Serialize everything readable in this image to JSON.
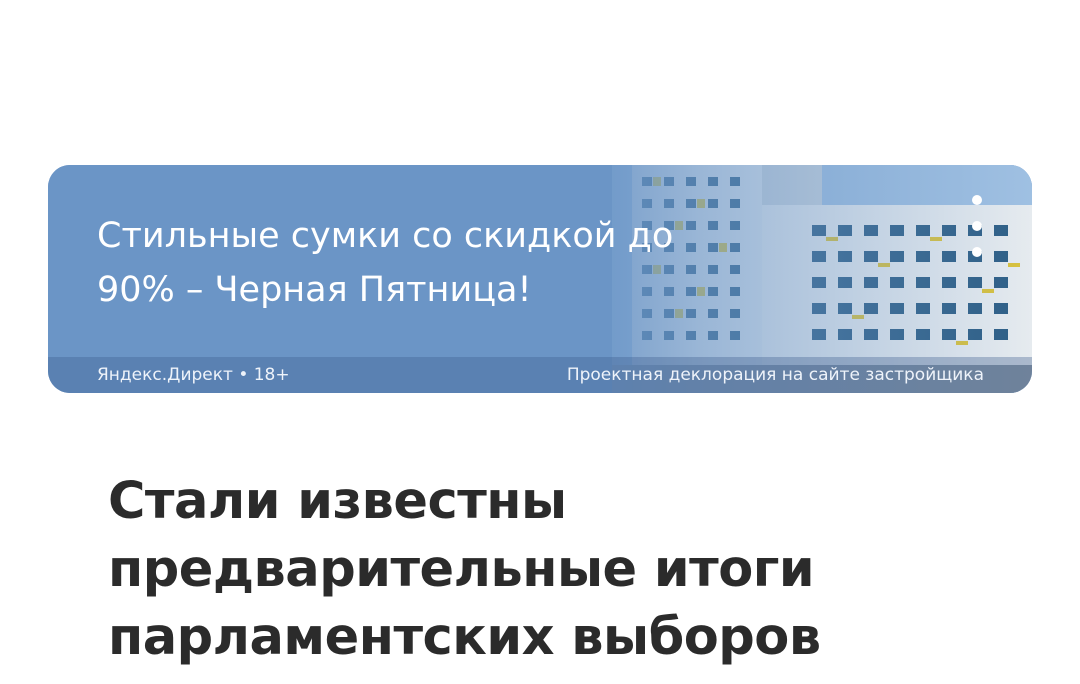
{
  "ad": {
    "headline": "Стильные сумки со скидкой до 90% – Черная Пятница!",
    "source_label": "Яндекс.Директ • 18+",
    "disclaimer": "Проектная деклорация на сайте застройщика",
    "menu_icon": "more-vertical-icon",
    "background_image": "residential-building-photo",
    "colors": {
      "banner_blue": "#6b95c6",
      "text": "#ffffff"
    }
  },
  "article": {
    "title": "Стали известны предварительные итоги парламентских выборов"
  }
}
